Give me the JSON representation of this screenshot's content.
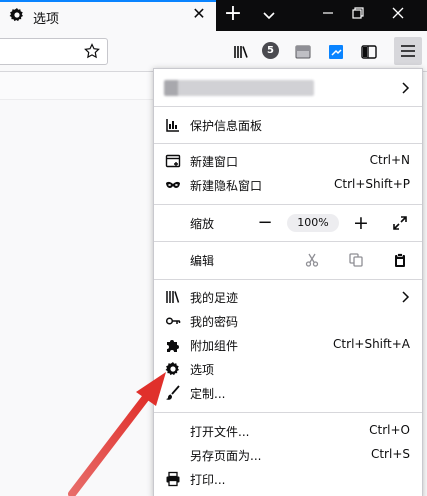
{
  "tab": {
    "title": "选项",
    "icon": "gear-icon"
  },
  "toolbar": {
    "badge_count": "5"
  },
  "menu": {
    "account_text": "",
    "protection_dashboard": "保护信息面板",
    "new_window": "新建窗口",
    "new_window_shortcut": "Ctrl+N",
    "new_private_window": "新建隐私窗口",
    "new_private_window_shortcut": "Ctrl+Shift+P",
    "zoom_label": "缩放",
    "zoom_minus": "−",
    "zoom_value": "100%",
    "zoom_plus": "+",
    "edit_label": "编辑",
    "library": "我的足迹",
    "logins": "我的密码",
    "addons": "附加组件",
    "addons_shortcut": "Ctrl+Shift+A",
    "options": "选项",
    "customize": "定制...",
    "open_file": "打开文件...",
    "open_file_shortcut": "Ctrl+O",
    "save_page": "另存页面为...",
    "save_page_shortcut": "Ctrl+S",
    "print": "打印..."
  },
  "colors": {
    "accent": "#0a84ff",
    "arrow": "#e0302b",
    "titlebar": "#0c0c0d"
  }
}
